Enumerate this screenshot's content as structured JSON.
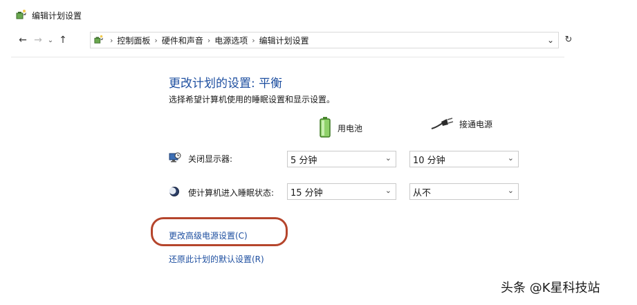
{
  "window": {
    "title": "编辑计划设置"
  },
  "breadcrumb": [
    "控制面板",
    "硬件和声音",
    "电源选项",
    "编辑计划设置"
  ],
  "main": {
    "heading": "更改计划的设置: 平衡",
    "subtitle": "选择希望计算机使用的睡眠设置和显示设置。",
    "columns": {
      "battery": "用电池",
      "plugged": "接通电源"
    },
    "rows": [
      {
        "label": "关闭显示器:",
        "icon": "monitor-clock-icon",
        "battery_value": "5 分钟",
        "plugged_value": "10 分钟"
      },
      {
        "label": "使计算机进入睡眠状态:",
        "icon": "moon-icon",
        "battery_value": "15 分钟",
        "plugged_value": "从不"
      }
    ],
    "links": {
      "advanced": "更改高级电源设置(C)",
      "restore": "还原此计划的默认设置(R)"
    }
  },
  "watermark": "头条 @K星科技站",
  "colors": {
    "link": "#1e4fa0",
    "annotation": "#b5452c"
  }
}
